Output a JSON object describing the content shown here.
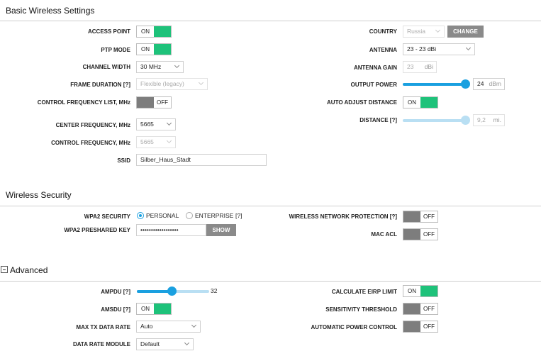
{
  "basic": {
    "title": "Basic Wireless Settings",
    "access_point": {
      "label": "ACCESS POINT",
      "state": "ON"
    },
    "ptp_mode": {
      "label": "PTP MODE",
      "state": "ON"
    },
    "channel_width": {
      "label": "CHANNEL WIDTH",
      "value": "30 MHz"
    },
    "frame_duration": {
      "label": "FRAME DURATION [?]",
      "value": "Flexible (legacy)"
    },
    "control_freq_list": {
      "label": "CONTROL FREQUENCY LIST, MHz",
      "state": "OFF"
    },
    "center_frequency": {
      "label": "CENTER FREQUENCY, MHz",
      "value": "5665"
    },
    "control_frequency": {
      "label": "CONTROL FREQUENCY, MHz",
      "value": "5665"
    },
    "ssid": {
      "label": "SSID",
      "value": "Silber_Haus_Stadt"
    },
    "country": {
      "label": "COUNTRY",
      "value": "Russia",
      "button": "CHANGE"
    },
    "antenna": {
      "label": "ANTENNA",
      "value": "23 - 23 dBi"
    },
    "antenna_gain": {
      "label": "ANTENNA GAIN",
      "value": "23",
      "unit": "dBi"
    },
    "output_power": {
      "label": "OUTPUT POWER",
      "value": "24",
      "unit": "dBm",
      "level": 1.0
    },
    "auto_adjust_distance": {
      "label": "AUTO ADJUST DISTANCE",
      "state": "ON"
    },
    "distance": {
      "label": "DISTANCE [?]",
      "value": "9,2",
      "unit": "mi.",
      "level": 1.0
    }
  },
  "security": {
    "title": "Wireless Security",
    "wpa2_security": {
      "label": "WPA2 SECURITY",
      "option_personal": "PERSONAL",
      "option_enterprise": "ENTERPRISE",
      "help": "[?]",
      "selected": "PERSONAL"
    },
    "wpa2_key": {
      "label": "WPA2 PRESHARED KEY",
      "value": "••••••••••••••••••",
      "button": "SHOW"
    },
    "network_protection": {
      "label": "WIRELESS NETWORK PROTECTION [?]",
      "state": "OFF"
    },
    "mac_acl": {
      "label": "MAC ACL",
      "state": "OFF"
    }
  },
  "advanced": {
    "title": "Advanced",
    "ampdu": {
      "label": "AMPDU [?]",
      "value": "32",
      "level": 0.48
    },
    "amsdu": {
      "label": "AMSDU [?]",
      "state": "ON"
    },
    "max_tx_rate": {
      "label": "MAX TX DATA RATE",
      "value": "Auto"
    },
    "data_rate_module": {
      "label": "DATA RATE MODULE",
      "value": "Default"
    },
    "calculate_eirp": {
      "label": "CALCULATE EIRP LIMIT",
      "state": "ON"
    },
    "sensitivity_threshold": {
      "label": "SENSITIVITY THRESHOLD",
      "state": "OFF"
    },
    "auto_power_control": {
      "label": "AUTOMATIC POWER CONTROL",
      "state": "OFF"
    }
  },
  "colors": {
    "on": "#1ec27a",
    "off": "#7d7d7d",
    "slider": "#1aa0e0",
    "slider_track": "#b9dff3"
  }
}
